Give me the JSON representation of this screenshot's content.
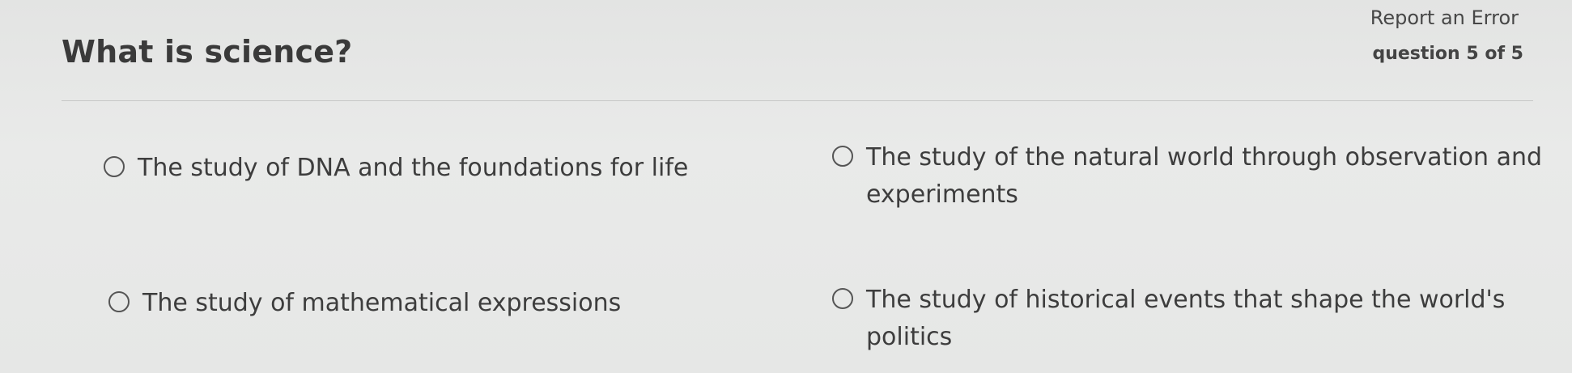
{
  "question": {
    "title": "What is science?",
    "report_label": "Report an Error",
    "progress": "question 5 of 5"
  },
  "options": [
    {
      "label": "The study of DNA and the foundations for life",
      "selected": false
    },
    {
      "label": "The study of the natural world through observation and experiments",
      "selected": false
    },
    {
      "label": "The study of mathematical expressions",
      "selected": false
    },
    {
      "label": "The study of historical events that shape the world's politics",
      "selected": false
    }
  ]
}
